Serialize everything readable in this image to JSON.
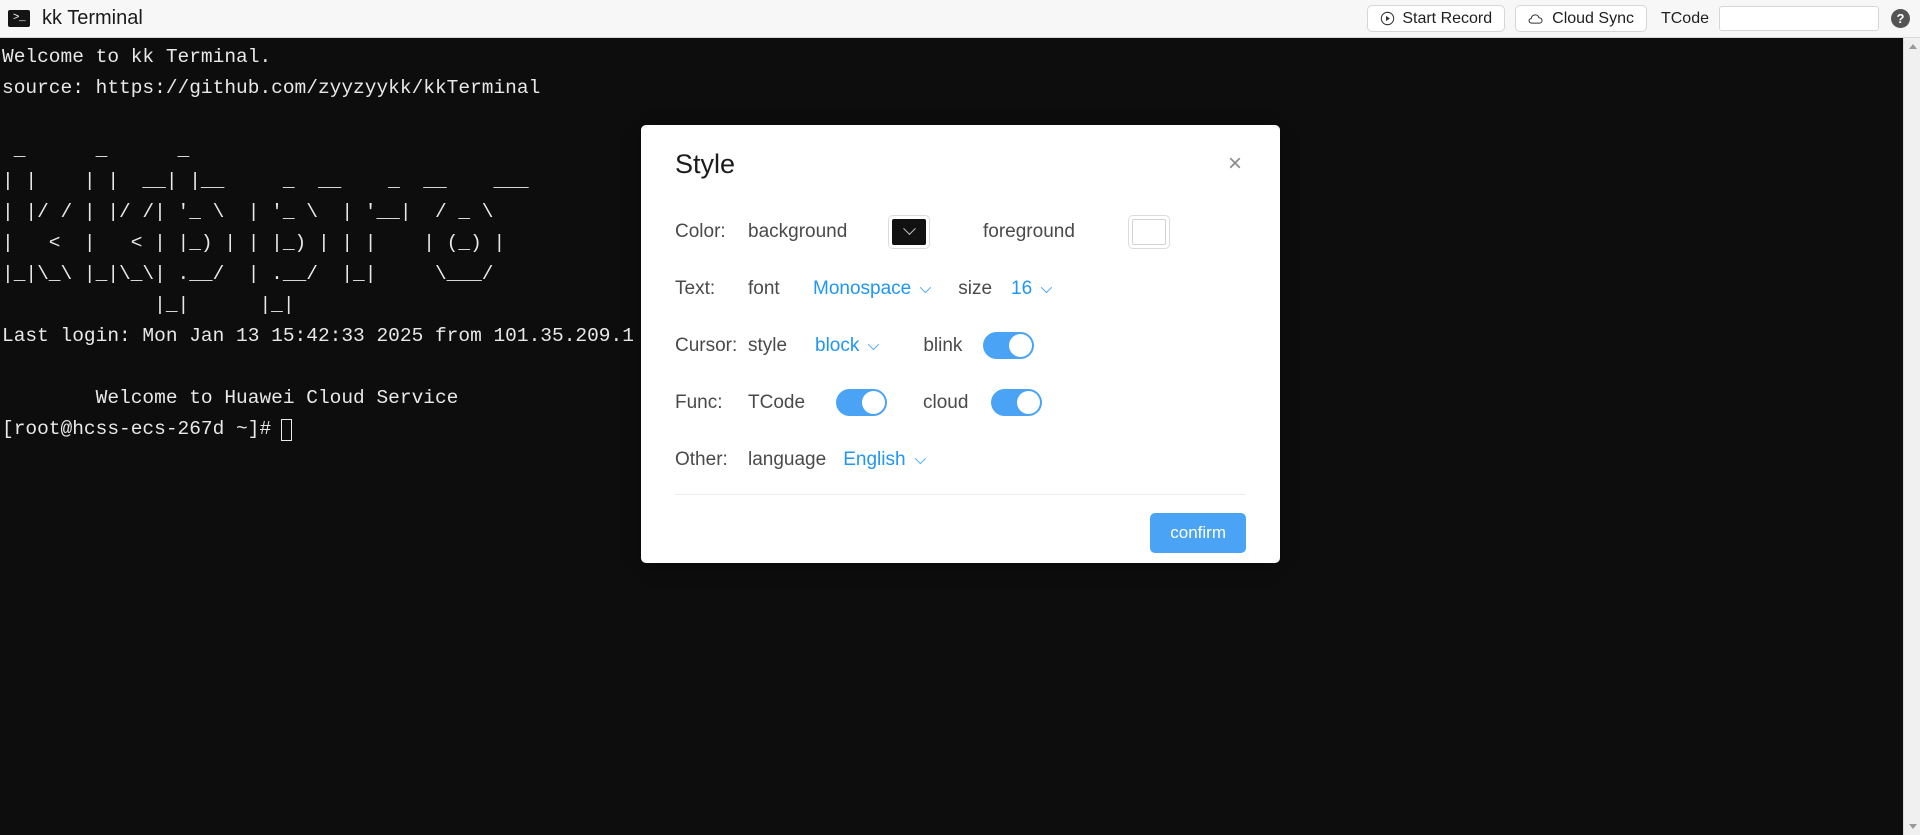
{
  "titlebar": {
    "app_icon": "terminal-prompt-icon",
    "title": "kk Terminal",
    "start_record_label": "Start Record",
    "start_record_icon": "record-play-circle-icon",
    "cloud_sync_label": "Cloud Sync",
    "cloud_sync_icon": "cloud-icon",
    "tcode_label": "TCode",
    "tcode_value": "",
    "tcode_placeholder": "",
    "help_label": "?"
  },
  "terminal": {
    "background": "#0d0d0d",
    "foreground": "#e8e8e8",
    "body": "Welcome to kk Terminal.\nsource: https://github.com/zyyzyykk/kkTerminal\n\n _      _      _\n| |    | |  __| |__     _  __    _  __    ___\n| |/ / | |/ /| '_ \\  | '_ \\  | '__|  / _ \\\n|   <  |   < | |_) | | |_) | | |    | (_) |\n|_|\\_\\ |_|\\_\\| .__/  | .__/  |_|     \\___/\n             |_|      |_|\nLast login: Mon Jan 13 15:42:33 2025 from 101.35.209.1\n\n        Welcome to Huawei Cloud Service\n",
    "prompt": "[root@hcss-ecs-267d ~]#",
    "cursor": "block"
  },
  "scrollbar": {
    "up_arrow": "scroll-up-arrow-icon",
    "down_arrow": "scroll-down-arrow-icon"
  },
  "modal": {
    "title": "Style",
    "close_label": "×",
    "rows": {
      "color": {
        "label": "Color:",
        "background_label": "background",
        "background_value": "#111111",
        "foreground_label": "foreground",
        "foreground_value": "#ffffff"
      },
      "text": {
        "label": "Text:",
        "font_label": "font",
        "font_value": "Monospace",
        "size_label": "size",
        "size_value": "16"
      },
      "cursor": {
        "label": "Cursor:",
        "style_label": "style",
        "style_value": "block",
        "blink_label": "blink",
        "blink_on": true
      },
      "func": {
        "label": "Func:",
        "tcode_label": "TCode",
        "tcode_on": true,
        "cloud_label": "cloud",
        "cloud_on": true
      },
      "other": {
        "label": "Other:",
        "language_label": "language",
        "language_value": "English"
      }
    },
    "confirm_label": "confirm",
    "accent_color": "#4aa3f5"
  }
}
